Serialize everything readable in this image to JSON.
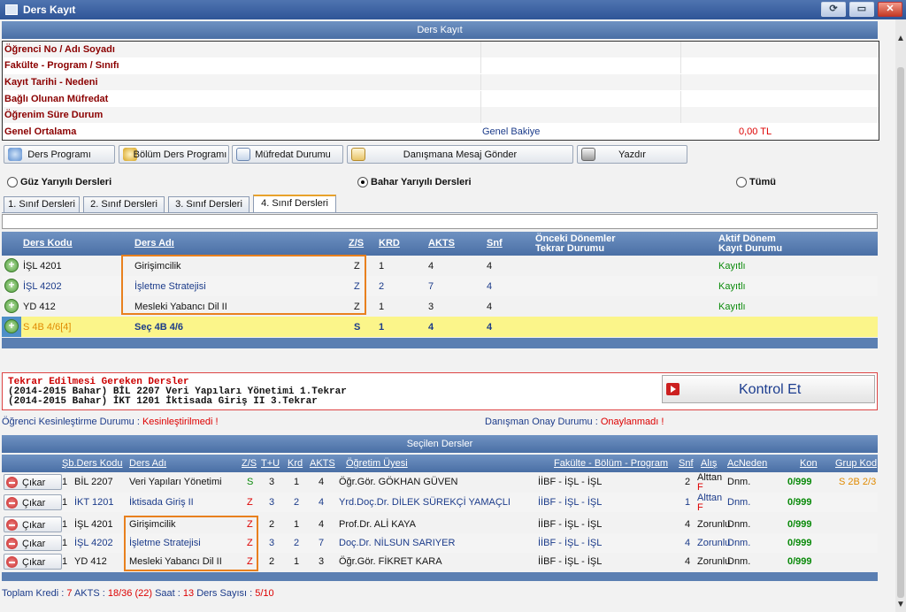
{
  "window": {
    "title": "Ders Kayıt"
  },
  "header": {
    "title": "Ders Kayıt"
  },
  "student_info": {
    "rows": [
      {
        "label": "Öğrenci No / Adı Soyadı"
      },
      {
        "label": "Fakülte - Program / Sınıfı"
      },
      {
        "label": "Kayıt Tarihi - Nedeni"
      },
      {
        "label": "Bağlı Olunan Müfredat"
      },
      {
        "label": "Öğrenim Süre Durum"
      },
      {
        "label": "Genel Ortalama"
      }
    ],
    "balance_label": "Genel Bakiye",
    "balance_value": "0,00 TL"
  },
  "toolbar": {
    "ders_programi": "Ders Programı",
    "bolum_ders_programi": "Bölüm Ders Programı",
    "mufredat_durumu": "Müfredat Durumu",
    "danismana_mesaj": "Danışmana Mesaj Gönder",
    "yazdir": "Yazdır"
  },
  "semester": {
    "guz": "Güz Yarıyılı Dersleri",
    "bahar": "Bahar Yarıyılı Dersleri",
    "tumu": "Tümü",
    "selected": "bahar"
  },
  "tabs": [
    "1. Sınıf Dersleri",
    "2. Sınıf Dersleri",
    "3. Sınıf Dersleri",
    "4. Sınıf Dersleri"
  ],
  "course_grid": {
    "headers": {
      "kod": "Ders Kodu",
      "ad": "Ders Adı",
      "zs": "Z/S",
      "krd": "KRD",
      "akts": "AKTS",
      "snf": "Snf",
      "onceki1": "Önceki Dönemler",
      "onceki2": "Tekrar Durumu",
      "aktif1": "Aktif Dönem",
      "aktif2": "Kayıt Durumu"
    },
    "rows": [
      {
        "kod": "İŞL 4201",
        "ad": "Girişimcilik",
        "zs": "Z",
        "krd": "1",
        "akts": "4",
        "snf": "4",
        "durum": "Kayıtlı"
      },
      {
        "kod": "İŞL 4202",
        "ad": "İşletme Stratejisi",
        "zs": "Z",
        "krd": "2",
        "akts": "7",
        "snf": "4",
        "durum": "Kayıtlı"
      },
      {
        "kod": "YD 412",
        "ad": "Mesleki Yabancı Dil II",
        "zs": "Z",
        "krd": "1",
        "akts": "3",
        "snf": "4",
        "durum": "Kayıtlı"
      },
      {
        "kod": "S 4B 4/6[4]",
        "ad": "Seç 4B 4/6",
        "zs": "S",
        "krd": "1",
        "akts": "4",
        "snf": "4",
        "durum": ""
      }
    ]
  },
  "repeat": {
    "title": "Tekrar Edilmesi Gereken Dersler",
    "line1": "(2014-2015 Bahar) BİL 2207 Veri Yapıları Yönetimi 1.Tekrar",
    "line2": "(2014-2015 Bahar) İKT 1201 İktisada Giriş II 3.Tekrar",
    "button": "Kontrol Et"
  },
  "status": {
    "kesin_label": "Öğrenci Kesinleştirme Durumu :",
    "kesin_value": "Kesinleştirilmedi !",
    "onay_label": "Danışman Onay Durumu :",
    "onay_value": "Onaylanmadı !"
  },
  "selected": {
    "title": "Seçilen Dersler",
    "headers": {
      "sb": "Şb.Ders Kodu",
      "ad": "Ders Adı",
      "zs": "Z/S",
      "tu": "T+U",
      "krd": "Krd",
      "akts": "AKTS",
      "ogretim": "Öğretim Üyesi",
      "fakulte": "Fakülte - Bölüm - Program",
      "snf": "Snf",
      "alis": "Alış",
      "acneden": "AcNeden",
      "kon": "Kon",
      "grup": "Grup Kod"
    },
    "remove_label": "Çıkar",
    "rows": [
      {
        "sb": "1",
        "kod": "BİL 2207",
        "ad": "Veri Yapıları Yönetimi",
        "zs": "S",
        "tu": "3",
        "krd": "1",
        "akts": "4",
        "ogretim": "Öğr.Gör. GÖKHAN GÜVEN",
        "fakulte": "İİBF - İŞL - İŞL",
        "snf": "2",
        "alis": "Alttan",
        "alis2": "F",
        "acneden": "Dnm.",
        "kon": "0/999",
        "grup": "S 2B 2/3"
      },
      {
        "sb": "1",
        "kod": "İKT 1201",
        "ad": "İktisada Giriş II",
        "zs": "Z",
        "tu": "3",
        "krd": "2",
        "akts": "4",
        "ogretim": "Yrd.Doç.Dr. DİLEK SÜREKÇİ YAMAÇLI",
        "fakulte": "İİBF - İŞL - İŞL",
        "snf": "1",
        "alis": "Alttan",
        "alis2": "F",
        "acneden": "Dnm.",
        "kon": "0/999",
        "grup": ""
      },
      {
        "sb": "1",
        "kod": "İŞL 4201",
        "ad": "Girişimcilik",
        "zs": "Z",
        "tu": "2",
        "krd": "1",
        "akts": "4",
        "ogretim": "Prof.Dr. ALİ KAYA",
        "fakulte": "İİBF - İŞL - İŞL",
        "snf": "4",
        "alis": "Zorunlu",
        "alis2": "",
        "acneden": "Dnm.",
        "kon": "0/999",
        "grup": ""
      },
      {
        "sb": "1",
        "kod": "İŞL 4202",
        "ad": "İşletme Stratejisi",
        "zs": "Z",
        "tu": "3",
        "krd": "2",
        "akts": "7",
        "ogretim": "Doç.Dr. NİLSUN SARIYER",
        "fakulte": "İİBF - İŞL - İŞL",
        "snf": "4",
        "alis": "Zorunlu",
        "alis2": "",
        "acneden": "Dnm.",
        "kon": "0/999",
        "grup": ""
      },
      {
        "sb": "1",
        "kod": "YD 412",
        "ad": "Mesleki Yabancı Dil II",
        "zs": "Z",
        "tu": "2",
        "krd": "1",
        "akts": "3",
        "ogretim": "Öğr.Gör. FİKRET KARA",
        "fakulte": "İİBF - İŞL - İŞL",
        "snf": "4",
        "alis": "Zorunlu",
        "alis2": "",
        "acneden": "Dnm.",
        "kon": "0/999",
        "grup": ""
      }
    ]
  },
  "totals": {
    "kredi_label": "Toplam Kredi :",
    "kredi": "7",
    "akts_label": "AKTS :",
    "akts": "18/36 (22)",
    "saat_label": "Saat :",
    "saat": "13",
    "sayi_label": "Ders Sayısı :",
    "sayi": "5/10"
  }
}
